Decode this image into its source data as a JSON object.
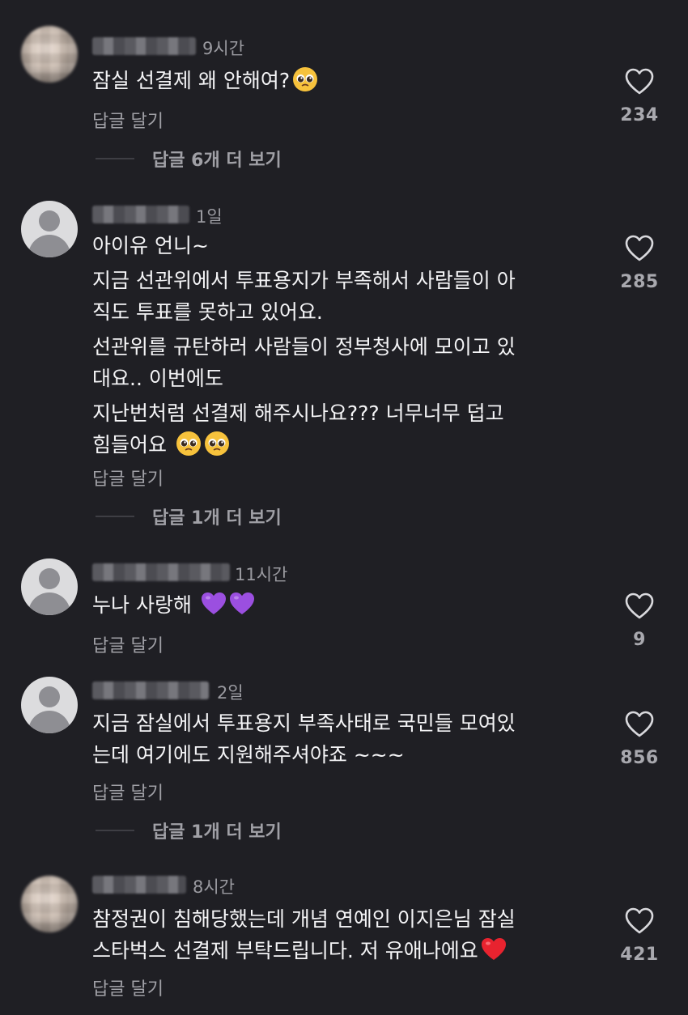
{
  "comments": [
    {
      "time": "9시간",
      "lines": [
        "잠실 선결제 왜 안해여?"
      ],
      "emoji_after": [
        "pleading-face-emoji"
      ],
      "reply_label": "답글 달기",
      "likes": "234",
      "more_replies": "답글 6개 더 보기"
    },
    {
      "time": "1일",
      "lines": [
        "아이유 언니~",
        "지금 선관위에서 투표용지가 부족해서 사람들이 아\n직도 투표를 못하고 있어요.",
        "선관위를 규탄하러 사람들이 정부청사에 모이고 있\n대요.. 이번에도",
        "지난번처럼 선결제 해주시나요??? 너무너무 덥고\n힘들어요 "
      ],
      "emoji_after": [
        "pleading-face-emoji",
        "pleading-face-emoji"
      ],
      "reply_label": "답글 달기",
      "likes": "285",
      "more_replies": "답글 1개 더 보기"
    },
    {
      "time": "11시간",
      "lines": [
        "누나 사랑해 "
      ],
      "emoji_after": [
        "purple-heart-emoji",
        "purple-heart-emoji"
      ],
      "reply_label": "답글 달기",
      "likes": "9"
    },
    {
      "time": "2일",
      "lines": [
        "지금 잠실에서 투표용지 부족사태로 국민들 모여있\n는데 여기에도 지원해주셔야죠 ~~~"
      ],
      "reply_label": "답글 달기",
      "likes": "856",
      "more_replies": "답글 1개 더 보기"
    },
    {
      "time": "8시간",
      "lines": [
        "참정권이 침해당했는데 개념 연예인 이지은님 잠실\n스타벅스 선결제 부탁드립니다. 저 유애나에요"
      ],
      "emoji_after": [
        "red-heart-emoji"
      ],
      "reply_label": "답글 달기",
      "likes": "421"
    }
  ],
  "colors": {
    "background": "#1f1f24",
    "text": "#f4f4f6",
    "muted": "#a0a0a6"
  }
}
